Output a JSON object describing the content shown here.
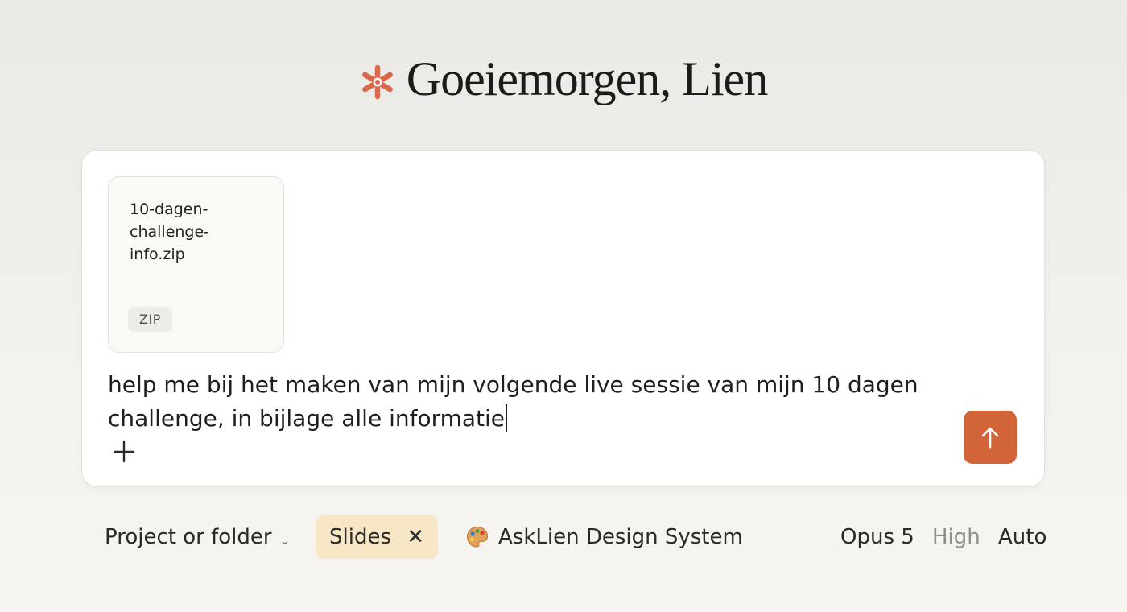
{
  "greeting": {
    "text": "Goeiemorgen, Lien",
    "icon": "asterisk-logo-icon",
    "accent_color": "#d9694a"
  },
  "composer": {
    "attachment": {
      "filename": "10-dagen-challenge-info.zip",
      "type_badge": "ZIP"
    },
    "prompt_text": "help me bij het maken van mijn volgende live sessie van mijn 10 dagen challenge, in bijlage alle informatie",
    "add_icon": "plus-icon",
    "send_icon": "arrow-up-icon",
    "send_color": "#d2643a"
  },
  "bottom_bar": {
    "project_label": "Project or folder",
    "project_chevron": "⌄",
    "slides_chip": {
      "label": "Slides",
      "close_glyph": "✕",
      "bg_color": "#f7e7c6"
    },
    "design_system": {
      "icon": "palette-icon",
      "label": "AskLien Design System"
    },
    "model": "Opus 5",
    "effort": "High",
    "mode": "Auto"
  }
}
